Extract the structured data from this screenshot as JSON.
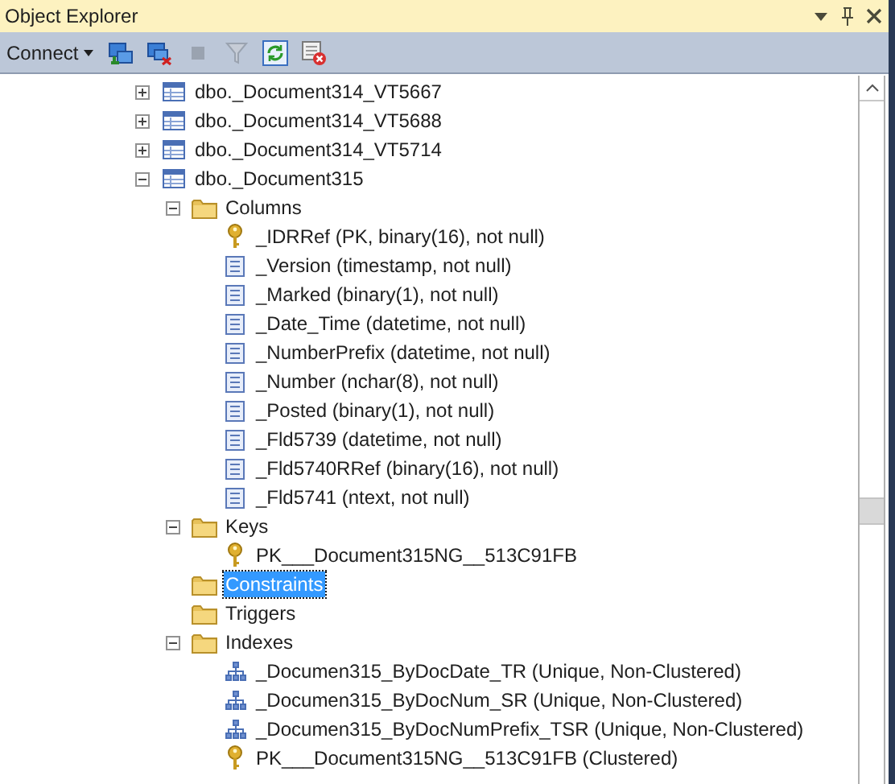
{
  "window": {
    "title": "Object Explorer"
  },
  "toolbar": {
    "connect": {
      "label": "Connect"
    },
    "buttons": [
      {
        "kind": "connect",
        "disabled": false
      },
      {
        "kind": "disconnect",
        "disabled": false
      },
      {
        "kind": "stop",
        "disabled": true
      },
      {
        "kind": "filter",
        "disabled": true
      },
      {
        "kind": "refresh",
        "disabled": false
      },
      {
        "kind": "remove",
        "disabled": false
      }
    ]
  },
  "tree": [
    {
      "label": "dbo._Document314_VT5667",
      "kind": "table",
      "expanded": false,
      "selected": false
    },
    {
      "label": "dbo._Document314_VT5688",
      "kind": "table",
      "expanded": false,
      "selected": false
    },
    {
      "label": "dbo._Document314_VT5714",
      "kind": "table",
      "expanded": false,
      "selected": false
    },
    {
      "label": "dbo._Document315",
      "kind": "table",
      "expanded": true,
      "selected": false,
      "children": [
        {
          "label": "Columns",
          "kind": "folder",
          "expanded": true,
          "selected": false,
          "children": [
            {
              "label": "_IDRRef (PK, binary(16), not null)",
              "kind": "key",
              "selected": false
            },
            {
              "label": "_Version (timestamp, not null)",
              "kind": "column",
              "selected": false
            },
            {
              "label": "_Marked (binary(1), not null)",
              "kind": "column",
              "selected": false
            },
            {
              "label": "_Date_Time (datetime, not null)",
              "kind": "column",
              "selected": false
            },
            {
              "label": "_NumberPrefix (datetime, not null)",
              "kind": "column",
              "selected": false
            },
            {
              "label": "_Number (nchar(8), not null)",
              "kind": "column",
              "selected": false
            },
            {
              "label": "_Posted (binary(1), not null)",
              "kind": "column",
              "selected": false
            },
            {
              "label": "_Fld5739 (datetime, not null)",
              "kind": "column",
              "selected": false
            },
            {
              "label": "_Fld5740RRef (binary(16), not null)",
              "kind": "column",
              "selected": false
            },
            {
              "label": "_Fld5741 (ntext, not null)",
              "kind": "column",
              "selected": false
            }
          ]
        },
        {
          "label": "Keys",
          "kind": "folder",
          "expanded": true,
          "selected": false,
          "children": [
            {
              "label": "PK___Document315NG__513C91FB",
              "kind": "key",
              "selected": false
            }
          ]
        },
        {
          "label": "Constraints",
          "kind": "folder",
          "selected": true
        },
        {
          "label": "Triggers",
          "kind": "folder",
          "selected": false
        },
        {
          "label": "Indexes",
          "kind": "folder",
          "expanded": true,
          "selected": false,
          "children": [
            {
              "label": "_Documen315_ByDocDate_TR (Unique, Non-Clustered)",
              "kind": "index",
              "selected": false
            },
            {
              "label": "_Documen315_ByDocNum_SR (Unique, Non-Clustered)",
              "kind": "index",
              "selected": false
            },
            {
              "label": "_Documen315_ByDocNumPrefix_TSR (Unique, Non-Clustered)",
              "kind": "index",
              "selected": false
            },
            {
              "label": "PK___Document315NG__513C91FB (Clustered)",
              "kind": "key",
              "selected": false
            }
          ]
        }
      ]
    }
  ]
}
